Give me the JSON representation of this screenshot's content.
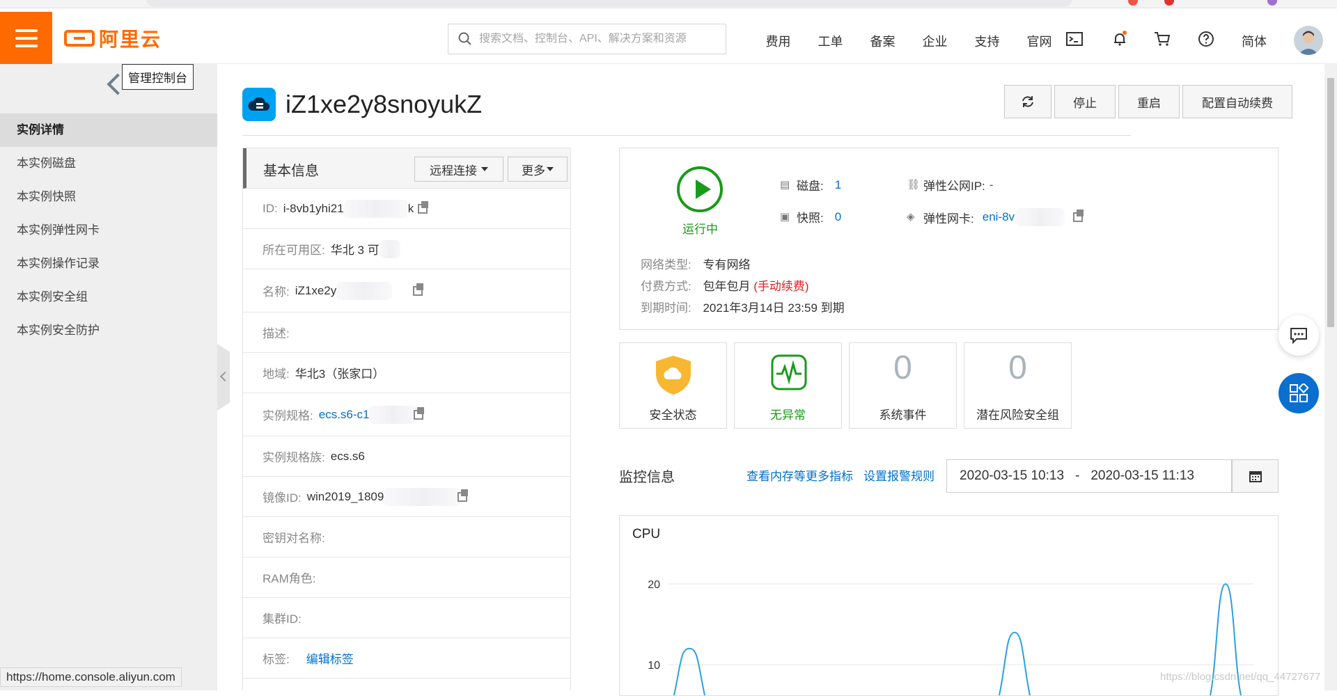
{
  "header": {
    "logo_text": "阿里云",
    "search_placeholder": "搜索文档、控制台、API、解决方案和资源",
    "nav": [
      "费用",
      "工单",
      "备案",
      "企业",
      "支持",
      "官网"
    ],
    "lang": "简体"
  },
  "sidebar": {
    "tooltip": "管理控制台",
    "items": [
      "实例详情",
      "本实例磁盘",
      "本实例快照",
      "本实例弹性网卡",
      "本实例操作记录",
      "本实例安全组",
      "本实例安全防护"
    ],
    "active_index": 0
  },
  "status_url": "https://home.console.aliyun.com",
  "instance": {
    "title": "iZ1xe2y8snoyukZ",
    "buttons": {
      "stop": "停止",
      "restart": "重启",
      "auto_renew": "配置自动续费"
    }
  },
  "basic_info": {
    "title": "基本信息",
    "remote_btn": "远程连接",
    "more_btn": "更多",
    "rows": {
      "id_label": "ID:",
      "id_value": "i-8vb1yhi21",
      "id_suffix": "k",
      "zone_label": "所在可用区:",
      "zone_value": "华北 3 可",
      "name_label": "名称:",
      "name_value": "iZ1xe2y",
      "desc_label": "描述:",
      "region_label": "地域:",
      "region_value": "华北3（张家口）",
      "spec_label": "实例规格:",
      "spec_value": "ecs.s6-c1",
      "family_label": "实例规格族:",
      "family_value": "ecs.s6",
      "image_label": "镜像ID:",
      "image_value": "win2019_1809",
      "keypair_label": "密钥对名称:",
      "ram_label": "RAM角色:",
      "cluster_label": "集群ID:",
      "tag_label": "标签:",
      "tag_link": "编辑标签"
    }
  },
  "status": {
    "running": "运行中",
    "disk_label": "磁盘:",
    "disk_value": "1",
    "snapshot_label": "快照:",
    "snapshot_value": "0",
    "eip_label": "弹性公网IP:",
    "eip_value": "-",
    "eni_label": "弹性网卡:",
    "eni_value": "eni-8v",
    "network_label": "网络类型:",
    "network_value": "专有网络",
    "billing_label": "付费方式:",
    "billing_value": "包年包月",
    "billing_note": "(手动续费)",
    "expire_label": "到期时间:",
    "expire_value": "2021年3月14日 23:59 到期"
  },
  "cards": {
    "security": "安全状态",
    "normal": "无异常",
    "events_num": "0",
    "events": "系统事件",
    "risk_num": "0",
    "risk": "潜在风险安全组"
  },
  "monitor": {
    "title": "监控信息",
    "more_link": "查看内存等更多指标",
    "alarm_link": "设置报警规则",
    "start": "2020-03-15 10:13",
    "sep": "-",
    "end": "2020-03-15 11:13"
  },
  "chart_data": {
    "type": "line",
    "title": "CPU",
    "y_ticks": [
      "20",
      "10"
    ],
    "ylim": [
      0,
      25
    ],
    "series": [
      {
        "peaks": [
          12,
          14,
          20
        ]
      }
    ]
  },
  "watermark": "https://blog.csdn.net/qq_44727677",
  "colors": {
    "brand": "#ff6a00",
    "link": "#0070cc",
    "running": "#1a9a1a",
    "danger": "#e02020",
    "float_blue": "#0a6fcf"
  }
}
